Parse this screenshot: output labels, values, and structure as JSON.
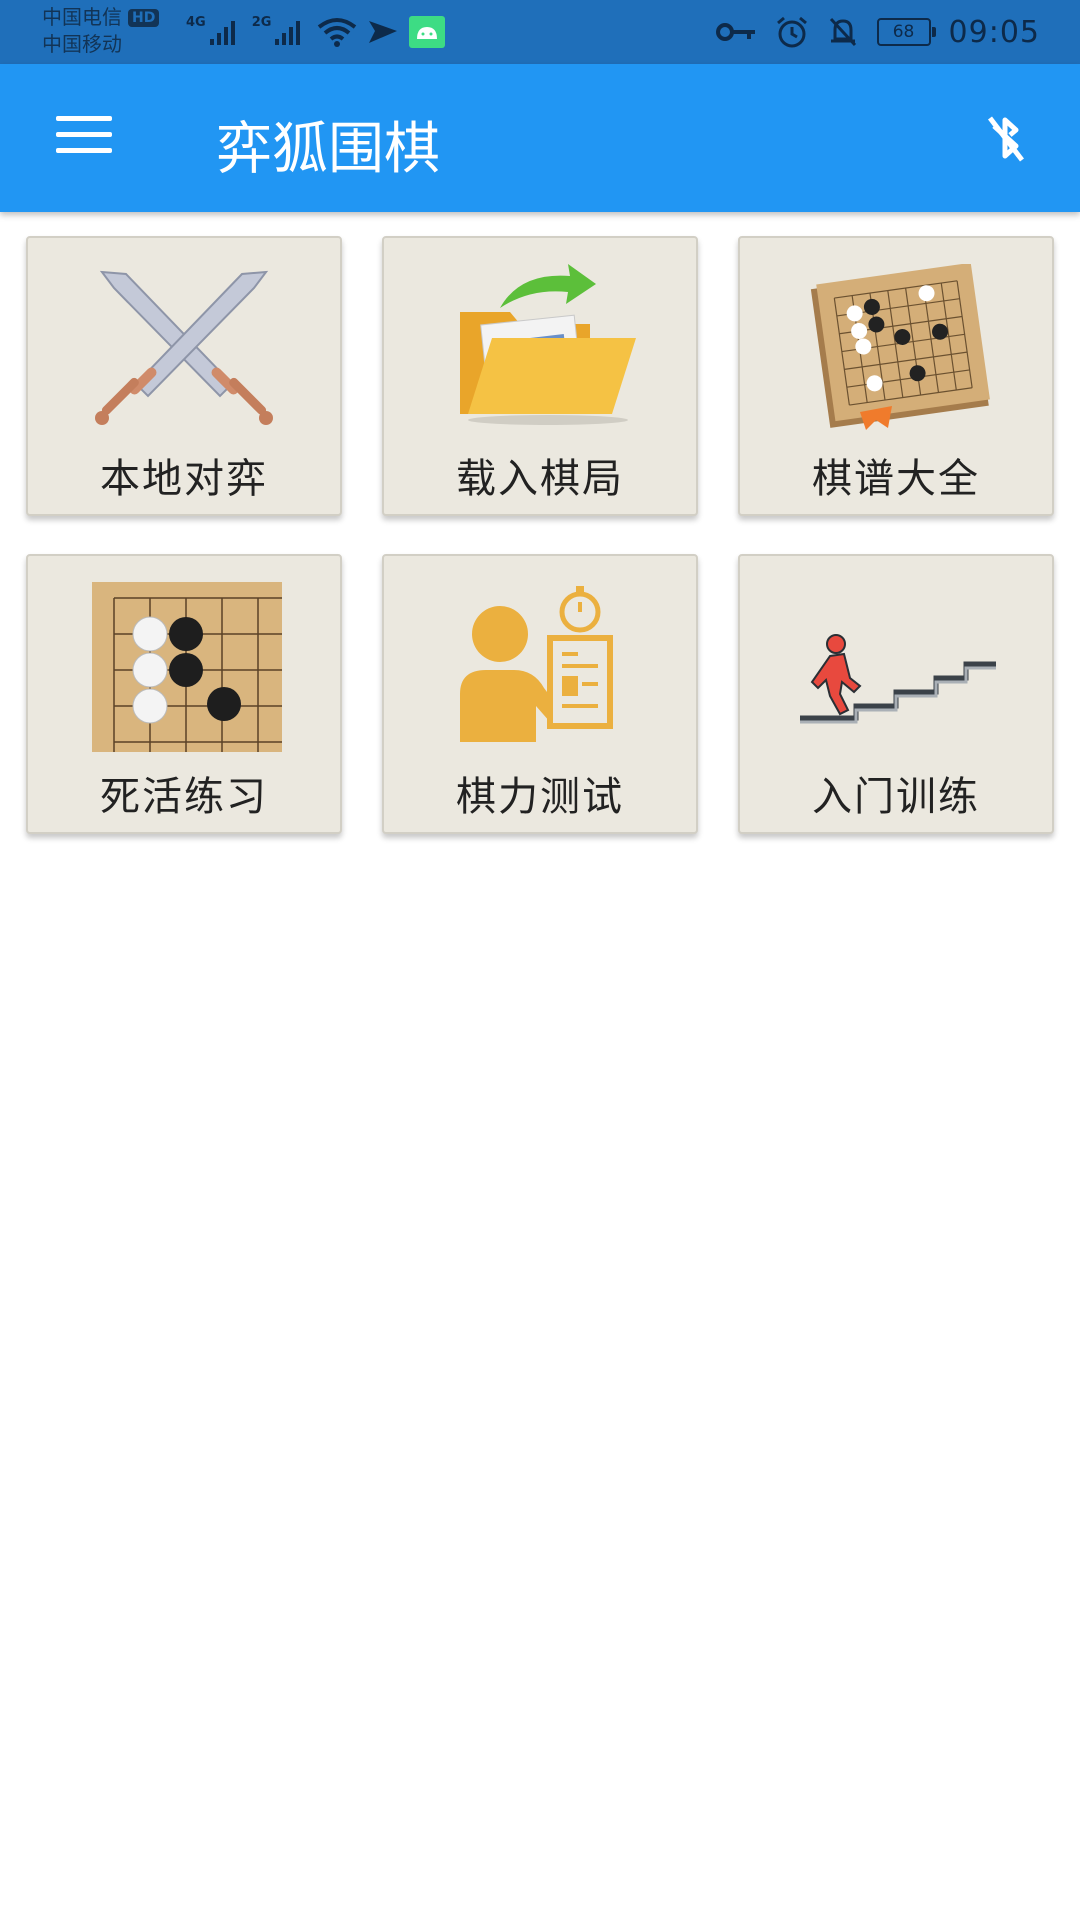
{
  "status_bar": {
    "carrier1": "中国电信",
    "hd_label": "HD",
    "carrier2": "中国移动",
    "net1": "4G",
    "net2": "2G",
    "battery": "68",
    "time": "09:05"
  },
  "app_bar": {
    "title": "弈狐围棋",
    "menu_icon": "hamburger-menu-icon",
    "bluetooth_icon": "bluetooth-off-icon"
  },
  "tiles": [
    {
      "label": "本地对弈",
      "icon": "crossed-swords-icon"
    },
    {
      "label": "载入棋局",
      "icon": "folder-load-icon"
    },
    {
      "label": "棋谱大全",
      "icon": "go-book-icon"
    },
    {
      "label": "死活练习",
      "icon": "go-stones-icon"
    },
    {
      "label": "棋力测试",
      "icon": "person-test-icon"
    },
    {
      "label": "入门训练",
      "icon": "stairs-climb-icon"
    }
  ],
  "colors": {
    "status_bar": "#1f6fba",
    "app_bar": "#2196f3",
    "tile_bg": "#ebe8df"
  }
}
